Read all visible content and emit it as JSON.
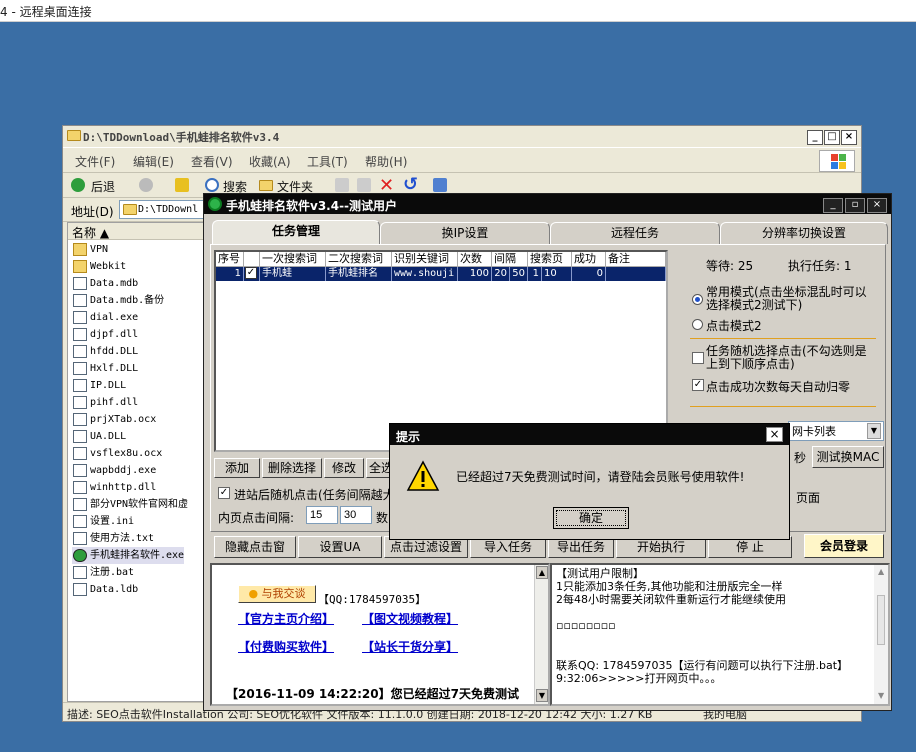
{
  "rdp": {
    "title": "4 - 远程桌面连接"
  },
  "explorer": {
    "title": "D:\\TDDownload\\手机蛙排名软件v3.4",
    "menu": [
      "文件(F)",
      "编辑(E)",
      "查看(V)",
      "收藏(A)",
      "工具(T)",
      "帮助(H)"
    ],
    "toolbar": {
      "back": "后退",
      "search": "搜索",
      "folders": "文件夹"
    },
    "address_label": "地址(D)",
    "address_value": "D:\\TDDownl",
    "column_name": "名称",
    "files": [
      {
        "name": "VPN",
        "type": "folder"
      },
      {
        "name": "Webkit",
        "type": "folder"
      },
      {
        "name": "Data.mdb",
        "type": "doc"
      },
      {
        "name": "Data.mdb.备份",
        "type": "doc"
      },
      {
        "name": "dial.exe",
        "type": "doc"
      },
      {
        "name": "djpf.dll",
        "type": "doc"
      },
      {
        "name": "hfdd.DLL",
        "type": "doc"
      },
      {
        "name": "Hxlf.DLL",
        "type": "doc"
      },
      {
        "name": "IP.DLL",
        "type": "doc"
      },
      {
        "name": "pihf.dll",
        "type": "doc"
      },
      {
        "name": "prjXTab.ocx",
        "type": "doc"
      },
      {
        "name": "UA.DLL",
        "type": "doc"
      },
      {
        "name": "vsflex8u.ocx",
        "type": "doc"
      },
      {
        "name": "wapbddj.exe",
        "type": "doc"
      },
      {
        "name": "winhttp.dll",
        "type": "doc"
      },
      {
        "name": "部分VPN软件官网和虚",
        "type": "doc"
      },
      {
        "name": "设置.ini",
        "type": "doc"
      },
      {
        "name": "使用方法.txt",
        "type": "doc"
      },
      {
        "name": "手机蛙排名软件.exe",
        "type": "app"
      },
      {
        "name": "注册.bat",
        "type": "doc"
      },
      {
        "name": "Data.ldb",
        "type": "doc"
      }
    ],
    "status": "描述: SEO点击软件Installation 公司: SEO优化软件 文件版本: 11.1.0.0 创建日期: 2018-12-20 12:42 大小: 1.27 KB",
    "status_right": "我的电脑"
  },
  "app": {
    "title": "手机蛙排名软件v3.4--测试用户",
    "tabs": [
      "任务管理",
      "换IP设置",
      "远程任务",
      "分辨率切换设置"
    ],
    "grid_headers": [
      "序号",
      "",
      "一次搜索词",
      "二次搜索词",
      "识别关键词",
      "次数",
      "间隔",
      "搜索页",
      "成功",
      "备注"
    ],
    "row": {
      "seq": "1",
      "checked": "✓",
      "kw1": "手机蛙",
      "kw2": "手机蛙排名",
      "ident": "www.shouji",
      "count": "100",
      "interval_a": "20",
      "interval_b": "50",
      "page_a": "1",
      "page_b": "10",
      "success": "0",
      "note": ""
    },
    "buttons_row1": {
      "add": "添加",
      "delete_sel": "删除选择",
      "edit": "修改",
      "all": "全选"
    },
    "random_click_label": "进站后随机点击(任务间隔越大",
    "inner_click_label": "内页点击间隔:",
    "inner_click_a": "15",
    "inner_click_b": "30",
    "inner_click_suffix": "数",
    "waiting_label": "等待: 25",
    "running_label": "执行任务: 1",
    "mode1": "常用模式(点击坐标混乱时可以选择模式2测试下)",
    "mode2": "点击模式2",
    "random_task_opt": "任务随机选择点击(不勾选则是上到下顺序点击)",
    "auto_reset_opt": "点击成功次数每天自动归零",
    "nic_select": "网卡列表",
    "sec_label": "秒",
    "test_mac_btn": "测试换MAC",
    "page_label": "页面",
    "bottom_buttons": [
      "隐藏点击窗",
      "设置UA",
      "点击过滤设置",
      "导入任务",
      "导出任务",
      "开始执行",
      "停 止"
    ],
    "member_login": "会员登录",
    "left_log": {
      "chat_btn": "与我交谈",
      "qq": "【QQ:1784597035】",
      "link1": "【官方主页介绍】",
      "link2": "【图文视频教程】",
      "link3": "【付费购买软件】",
      "link4": "【站长干货分享】",
      "notice": "【2016-11-09 14:22:20】您已经超过7天免费测试"
    },
    "right_log": {
      "l1": "【测试用户限制】",
      "l2": "1只能添加3条任务,其他功能和注册版完全一样",
      "l3": "2每48小时需要关闭软件重新运行才能继续使用",
      "l4": "▫▫▫▫▫▫▫▫",
      "l5": "联系QQ: 1784597035【运行有问题可以执行下注册.bat】",
      "l6": "9:32:06>>>>>打开网页中。。。"
    }
  },
  "dialog": {
    "title": "提示",
    "message": "已经超过7天免费测试时间，请登陆会员账号使用软件!",
    "ok": "确定"
  }
}
